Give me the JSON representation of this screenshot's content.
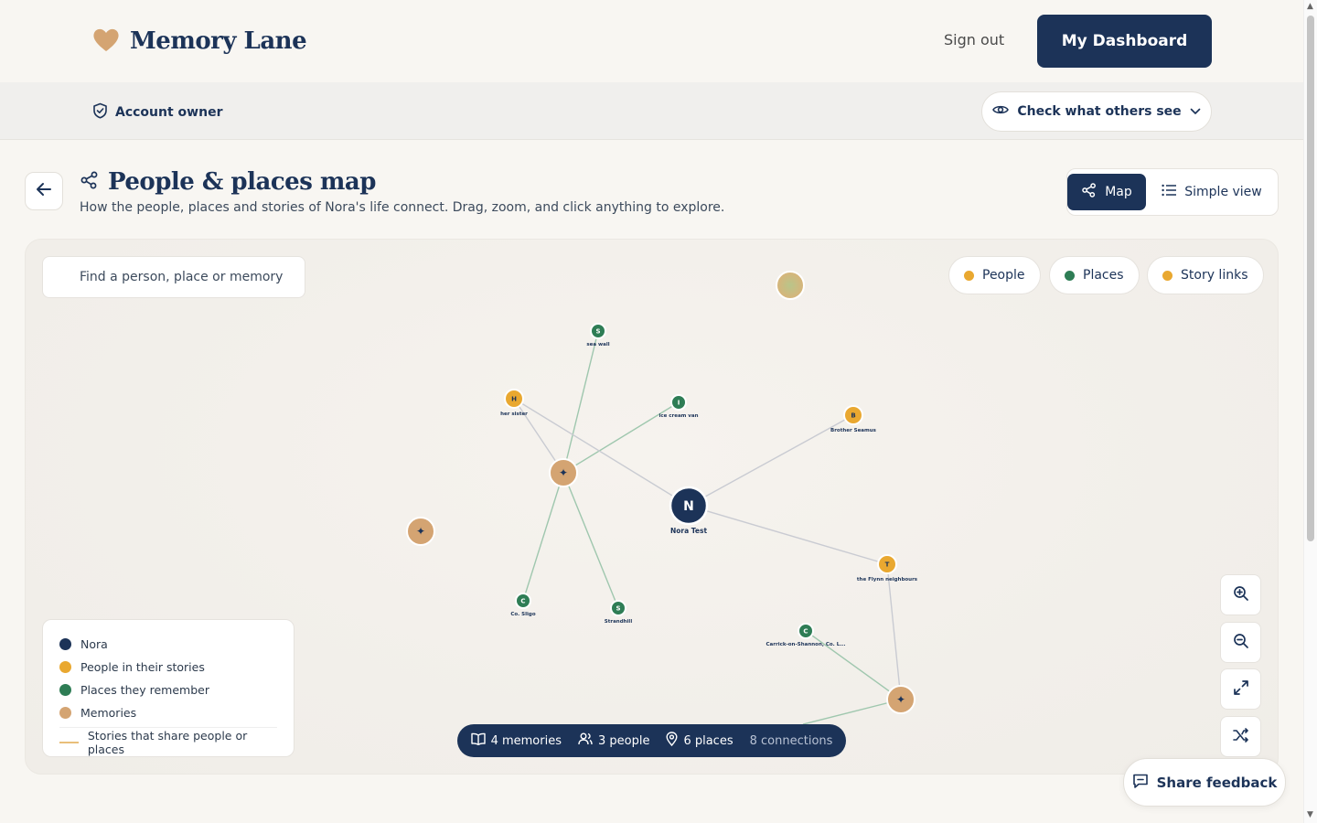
{
  "app": {
    "name": "Memory Lane"
  },
  "header": {
    "signout_label": "Sign out",
    "dashboard_label": "My Dashboard"
  },
  "subbar": {
    "role_label": "Account owner",
    "check_label": "Check what others see"
  },
  "page": {
    "title": "People & places map",
    "subtitle": "How the people, places and stories of Nora's life connect. Drag, zoom, and click anything to explore."
  },
  "view_toggle": {
    "map_label": "Map",
    "simple_label": "Simple view",
    "selected": "Map"
  },
  "search": {
    "placeholder": "Find a person, place or memory"
  },
  "filters": [
    {
      "label": "People",
      "color": "#e9a830"
    },
    {
      "label": "Places",
      "color": "#2e7d55"
    },
    {
      "label": "Story links",
      "color": "#e9a830"
    }
  ],
  "legend": {
    "items": [
      {
        "label": "Nora",
        "color": "#1c3358"
      },
      {
        "label": "People in their stories",
        "color": "#e9a830"
      },
      {
        "label": "Places they remember",
        "color": "#2e7d55"
      },
      {
        "label": "Memories",
        "color": "#d4a472"
      }
    ],
    "line_label": "Stories that share people or places"
  },
  "graph": {
    "nodes": [
      {
        "id": "nora",
        "type": "center",
        "initial": "N",
        "label": "Nora Test"
      },
      {
        "id": "her-sister",
        "type": "person",
        "initial": "H",
        "label": "her sister"
      },
      {
        "id": "brother-seamus",
        "type": "person",
        "initial": "B",
        "label": "Brother Seamus"
      },
      {
        "id": "flynn",
        "type": "person",
        "initial": "T",
        "label": "the Flynn neighbours"
      },
      {
        "id": "sea-wall",
        "type": "place",
        "initial": "S",
        "label": "sea wall"
      },
      {
        "id": "ice-cream-van",
        "type": "place",
        "initial": "I",
        "label": "ice cream van"
      },
      {
        "id": "co-sligo",
        "type": "place",
        "initial": "C",
        "label": "Co. Sligo"
      },
      {
        "id": "strandhill",
        "type": "place",
        "initial": "S",
        "label": "Strandhill"
      },
      {
        "id": "carrick",
        "type": "place",
        "initial": "C",
        "label": "Carrick-on-Shannon, Co. L..."
      },
      {
        "id": "memory-1",
        "type": "memory",
        "initial": "✦",
        "label": ""
      },
      {
        "id": "memory-2",
        "type": "memory",
        "initial": "✦",
        "label": ""
      },
      {
        "id": "memory-3",
        "type": "memory",
        "initial": "✦",
        "label": ""
      },
      {
        "id": "memory-4",
        "type": "memory",
        "initial": "",
        "label": ""
      }
    ],
    "links": [
      [
        "memory-1",
        "her-sister"
      ],
      [
        "memory-1",
        "sea-wall"
      ],
      [
        "memory-1",
        "ice-cream-van"
      ],
      [
        "memory-1",
        "co-sligo"
      ],
      [
        "memory-1",
        "strandhill"
      ],
      [
        "nora",
        "her-sister"
      ],
      [
        "nora",
        "brother-seamus"
      ],
      [
        "nora",
        "flynn"
      ],
      [
        "flynn",
        "memory-3"
      ],
      [
        "memory-3",
        "carrick"
      ]
    ]
  },
  "stats": {
    "memories": "4 memories",
    "people": "3 people",
    "places": "6 places",
    "connections": "8 connections"
  },
  "feedback_label": "Share feedback",
  "colors": {
    "navy": "#1c3358",
    "person": "#e9a830",
    "place": "#2e7d55",
    "memory": "#d4a472",
    "background": "#f8f6f2"
  }
}
